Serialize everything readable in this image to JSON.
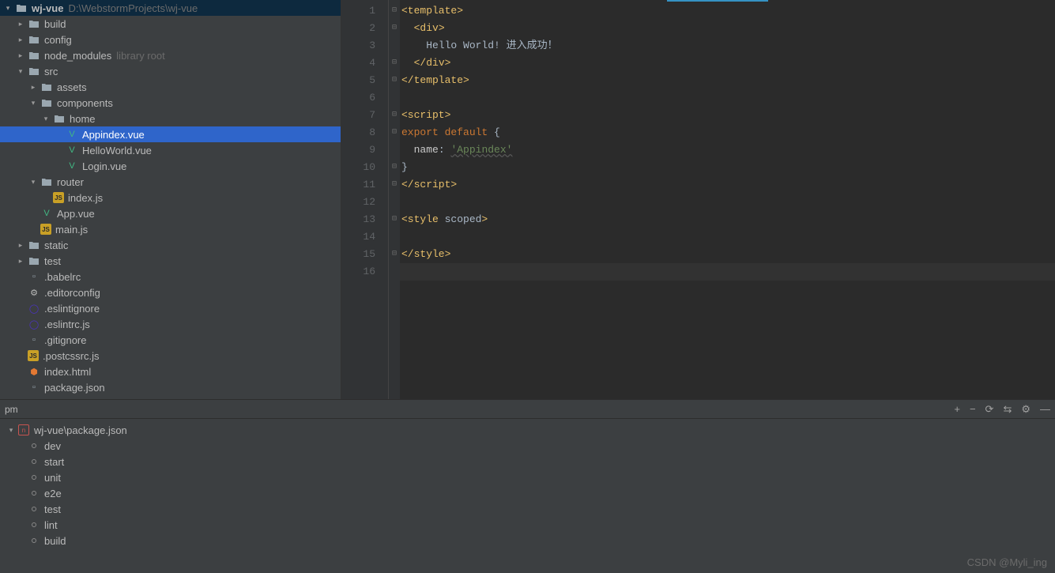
{
  "project": {
    "name": "wj-vue",
    "path": "D:\\WebstormProjects\\wj-vue"
  },
  "tree": [
    {
      "depth": 0,
      "expand": "open",
      "icon": "folder",
      "label": "wj-vue",
      "hint": "D:\\WebstormProjects\\wj-vue",
      "bold": true
    },
    {
      "depth": 1,
      "expand": "closed",
      "icon": "folder",
      "label": "build"
    },
    {
      "depth": 1,
      "expand": "closed",
      "icon": "folder",
      "label": "config"
    },
    {
      "depth": 1,
      "expand": "closed",
      "icon": "folder",
      "label": "node_modules",
      "hint": "library root"
    },
    {
      "depth": 1,
      "expand": "open",
      "icon": "folder",
      "label": "src"
    },
    {
      "depth": 2,
      "expand": "closed",
      "icon": "folder",
      "label": "assets"
    },
    {
      "depth": 2,
      "expand": "open",
      "icon": "folder",
      "label": "components"
    },
    {
      "depth": 3,
      "expand": "open",
      "icon": "folder",
      "label": "home"
    },
    {
      "depth": 4,
      "expand": "none",
      "icon": "vue",
      "label": "Appindex.vue",
      "active": true
    },
    {
      "depth": 4,
      "expand": "none",
      "icon": "vue",
      "label": "HelloWorld.vue"
    },
    {
      "depth": 4,
      "expand": "none",
      "icon": "vue",
      "label": "Login.vue"
    },
    {
      "depth": 2,
      "expand": "open",
      "icon": "folder",
      "label": "router"
    },
    {
      "depth": 3,
      "expand": "none",
      "icon": "js",
      "label": "index.js"
    },
    {
      "depth": 2,
      "expand": "none",
      "icon": "vue",
      "label": "App.vue"
    },
    {
      "depth": 2,
      "expand": "none",
      "icon": "js",
      "label": "main.js"
    },
    {
      "depth": 1,
      "expand": "closed",
      "icon": "folder",
      "label": "static"
    },
    {
      "depth": 1,
      "expand": "closed",
      "icon": "folder",
      "label": "test"
    },
    {
      "depth": 1,
      "expand": "none",
      "icon": "cfg",
      "label": ".babelrc"
    },
    {
      "depth": 1,
      "expand": "none",
      "icon": "gear",
      "label": ".editorconfig"
    },
    {
      "depth": 1,
      "expand": "none",
      "icon": "eslint",
      "label": ".eslintignore"
    },
    {
      "depth": 1,
      "expand": "none",
      "icon": "eslint",
      "label": ".eslintrc.js"
    },
    {
      "depth": 1,
      "expand": "none",
      "icon": "cfg",
      "label": ".gitignore"
    },
    {
      "depth": 1,
      "expand": "none",
      "icon": "js",
      "label": ".postcssrc.js"
    },
    {
      "depth": 1,
      "expand": "none",
      "icon": "html",
      "label": "index.html"
    },
    {
      "depth": 1,
      "expand": "none",
      "icon": "cfg",
      "label": "package.json"
    }
  ],
  "editor": {
    "line_numbers": [
      "1",
      "2",
      "3",
      "4",
      "5",
      "6",
      "7",
      "8",
      "9",
      "10",
      "11",
      "12",
      "13",
      "14",
      "15",
      "16"
    ],
    "current_line_index": 15,
    "code": {
      "l1_tag_open": "<template>",
      "l2_div_open": "<div>",
      "l3_text": "Hello World! 进入成功！",
      "l4_div_close": "</div>",
      "l5_tag_close": "</template>",
      "l7_script_open": "<script>",
      "l8_export": "export",
      "l8_default": "default",
      "l8_brace": " {",
      "l9_name": "name",
      "l9_colon": ": ",
      "l9_val": "'Appindex'",
      "l10_brace": "}",
      "l11_script_close": "</script>",
      "l13_style_open_a": "<style ",
      "l13_style_open_b": "scoped",
      "l13_style_open_c": ">",
      "l15_style_close": "</style>"
    }
  },
  "npm_panel": {
    "title": "pm",
    "root": "wj-vue\\package.json",
    "scripts": [
      "dev",
      "start",
      "unit",
      "e2e",
      "test",
      "lint",
      "build"
    ]
  },
  "watermark": "CSDN @Myli_ing"
}
